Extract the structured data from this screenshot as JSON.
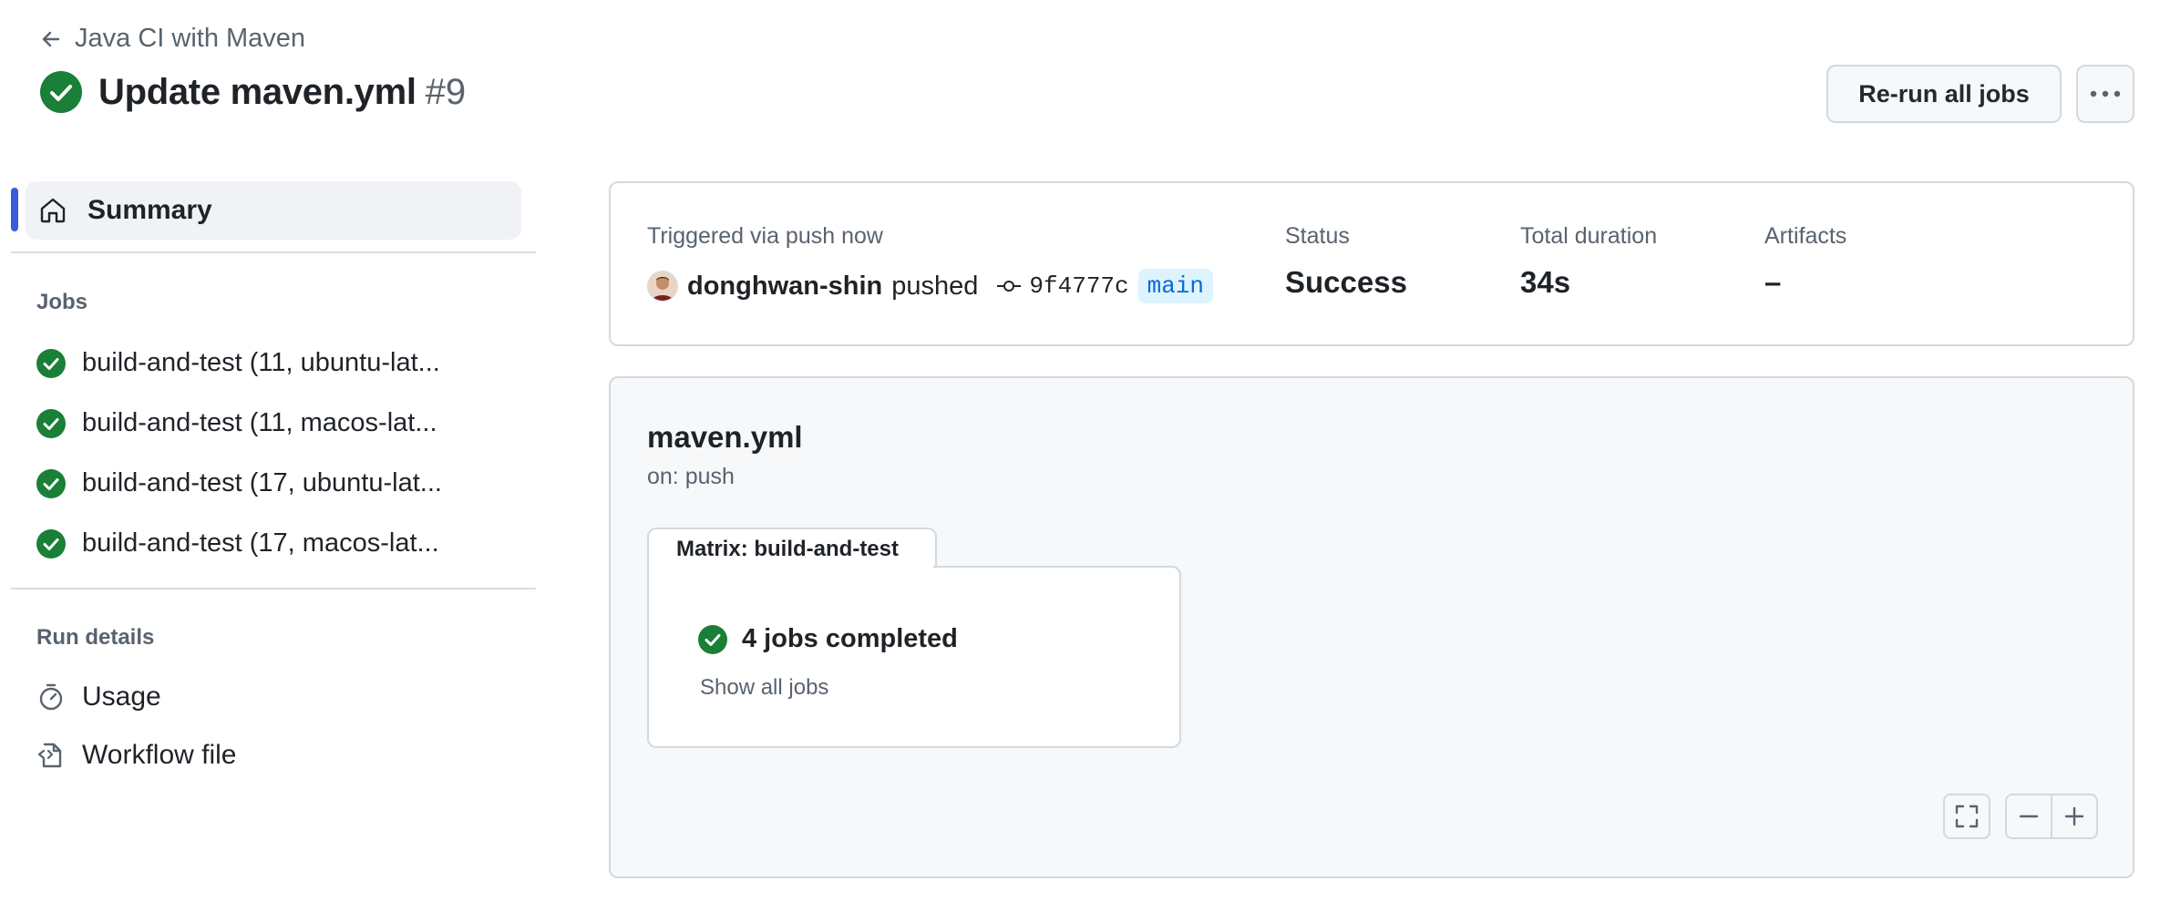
{
  "header": {
    "back_label": "Java CI with Maven",
    "title": "Update maven.yml",
    "run_number": "#9",
    "rerun_label": "Re-run all jobs"
  },
  "sidebar": {
    "summary_label": "Summary",
    "jobs_heading": "Jobs",
    "jobs": [
      {
        "label": "build-and-test (11, ubuntu-lat..."
      },
      {
        "label": "build-and-test (11, macos-lat..."
      },
      {
        "label": "build-and-test (17, ubuntu-lat..."
      },
      {
        "label": "build-and-test (17, macos-lat..."
      }
    ],
    "run_details_heading": "Run details",
    "run_details": [
      {
        "label": "Usage",
        "icon": "stopwatch-icon"
      },
      {
        "label": "Workflow file",
        "icon": "file-code-icon"
      }
    ]
  },
  "summary": {
    "triggered_label": "Triggered via push now",
    "user": "donghwan-shin",
    "action": "pushed",
    "commit": "9f4777c",
    "branch": "main",
    "status_label": "Status",
    "status_value": "Success",
    "duration_label": "Total duration",
    "duration_value": "34s",
    "artifacts_label": "Artifacts",
    "artifacts_value": "–"
  },
  "graph": {
    "workflow_name": "maven.yml",
    "trigger": "on: push",
    "matrix_label": "Matrix: build-and-test",
    "completed_label": "4 jobs completed",
    "show_all_label": "Show all jobs"
  },
  "colors": {
    "success": "#1a7f37",
    "accent": "#3a5bd9",
    "branch_bg": "#ddf4ff",
    "branch_fg": "#0969da"
  }
}
